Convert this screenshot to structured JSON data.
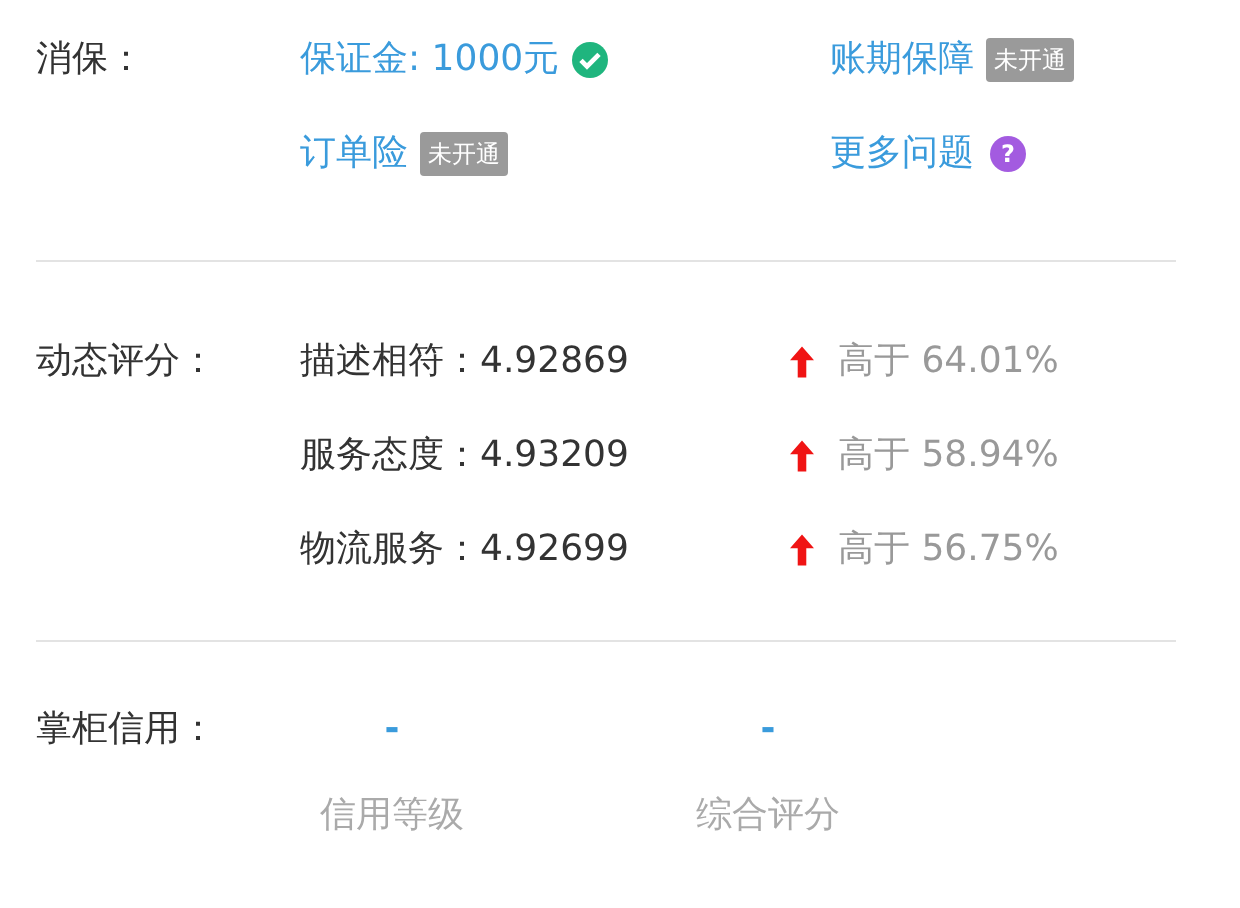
{
  "guarantee": {
    "label": "消保：",
    "items": [
      {
        "text": "保证金: 1000元",
        "kind": "verified"
      },
      {
        "text": "账期保障",
        "kind": "status",
        "badge": "未开通"
      },
      {
        "text": "订单险",
        "kind": "status",
        "badge": "未开通"
      },
      {
        "text": "更多问题",
        "kind": "help",
        "icon_text": "?"
      }
    ]
  },
  "ratings": {
    "label": "动态评分：",
    "rows": [
      {
        "score": "描述相符：4.92869",
        "rising": true,
        "compare": "高于 64.01%"
      },
      {
        "score": "服务态度：4.93209",
        "rising": true,
        "compare": "高于 58.94%"
      },
      {
        "score": "物流服务：4.92699",
        "rising": true,
        "compare": "高于 56.75%"
      }
    ]
  },
  "credit": {
    "label": "掌柜信用：",
    "items": [
      {
        "value": "-",
        "caption": "信用等级"
      },
      {
        "value": "-",
        "caption": "综合评分"
      }
    ]
  }
}
